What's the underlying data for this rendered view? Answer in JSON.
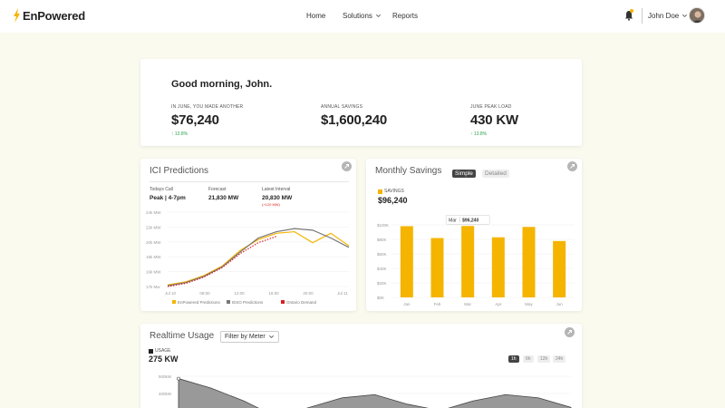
{
  "brand": {
    "name": "EnPowered",
    "accent": "#f5b400"
  },
  "nav": {
    "home": "Home",
    "solutions": "Solutions",
    "reports": "Reports"
  },
  "user": {
    "name": "John Doe"
  },
  "greeting": {
    "text": "Good morning, John.",
    "kpis": [
      {
        "label": "IN JUNE, YOU MADE ANOTHER",
        "value": "$76,240",
        "delta": "13.8%"
      },
      {
        "label": "ANNUAL SAVINGS",
        "value": "$1,600,240"
      },
      {
        "label": "JUNE PEAK LOAD",
        "value": "430 KW",
        "delta": "13.8%"
      }
    ]
  },
  "ici": {
    "title": "ICI Predictions",
    "stats": [
      {
        "label": "Todays Call",
        "value": "Peak | 4-7pm"
      },
      {
        "label": "Forecast",
        "value": "21,830 MW"
      },
      {
        "label": "Latest Interval",
        "value": "20,830 MW",
        "note": "(+120 MW)"
      }
    ],
    "legend": [
      "EnPowered Predictions",
      "IESO Predictions",
      "Ontario Demand"
    ]
  },
  "monthly": {
    "title": "Monthly Savings",
    "toggle_simple": "Simple",
    "toggle_detailed": "Detailed",
    "savings_label": "SAVINGS",
    "savings_value": "$96,240",
    "tooltip_month": "Mar",
    "tooltip_value": "$96,240"
  },
  "realtime": {
    "title": "Realtime Usage",
    "filter": "Filter by Meter",
    "usage_label": "USAGE",
    "usage_value": "275 KW",
    "ranges": [
      "1h",
      "6h",
      "12h",
      "24h"
    ]
  },
  "chart_data": [
    {
      "type": "line",
      "x": [
        "Jul 10",
        "08:00",
        "12:00",
        "16:00",
        "20:00",
        "Jul 11"
      ],
      "yticks": [
        "24k MW",
        "22k MW",
        "20k MW",
        "18k MW",
        "16k MW",
        "17k Mw"
      ],
      "series": [
        {
          "name": "EnPowered Predictions",
          "color": "#f5b400",
          "values": [
            15.2,
            15.6,
            16.4,
            17.6,
            19.6,
            21.0,
            21.8,
            22.0,
            20.6,
            21.8,
            20.2
          ]
        },
        {
          "name": "IESO Predictions",
          "color": "#777777",
          "values": [
            15.1,
            15.5,
            16.3,
            17.5,
            19.4,
            21.2,
            22.0,
            22.4,
            22.2,
            21.2,
            20.0
          ]
        },
        {
          "name": "Ontario Demand",
          "color": "#d92020",
          "values": [
            15.0,
            15.4,
            16.2,
            17.4,
            19.2,
            20.6,
            21.4
          ]
        }
      ]
    },
    {
      "type": "bar",
      "categories": [
        "Jan",
        "Feb",
        "Mar",
        "Apr",
        "May",
        "Jun"
      ],
      "values": [
        96000,
        80000,
        96240,
        81000,
        95000,
        76000
      ],
      "ylim": [
        0,
        110000
      ],
      "yticks": [
        "$100K",
        "$80K",
        "$60K",
        "$40K",
        "$20K",
        "$0K"
      ],
      "color": "#f5b400"
    },
    {
      "type": "area",
      "yticks": [
        "500kW",
        "400kW"
      ],
      "values": [
        420,
        390,
        350,
        300,
        330,
        360,
        370,
        340,
        320,
        350,
        370,
        360,
        330
      ]
    }
  ]
}
